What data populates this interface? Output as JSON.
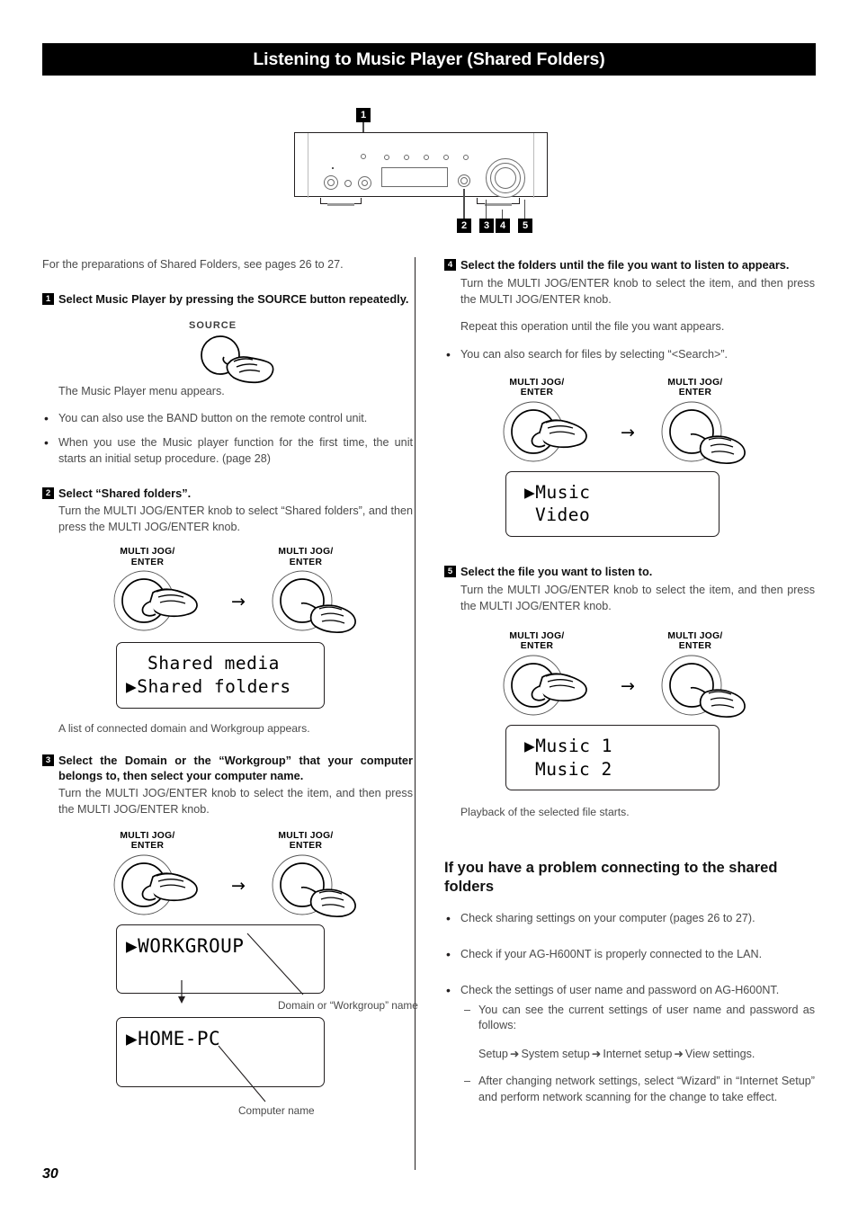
{
  "page": {
    "title": "Listening to Music Player (Shared Folders)",
    "number": "30"
  },
  "device_diagram": {
    "callouts_top": [
      "1"
    ],
    "callouts_bottom": [
      "2",
      "3",
      "4",
      "5"
    ]
  },
  "left_column": {
    "lead_in": "For the preparations of Shared Folders, see pages 26 to 27.",
    "step1": {
      "num": "1",
      "heading": "Select Music Player by pressing the SOURCE button repeatedly.",
      "button_label": "SOURCE",
      "result": "The Music Player menu appears.",
      "bullets": [
        "You can also use the BAND button on the remote control unit.",
        "When you use the Music player function for the first time, the unit starts an initial setup procedure. (page 28)"
      ]
    },
    "step2": {
      "num": "2",
      "heading": "Select “Shared folders”.",
      "body": "Turn the MULTI JOG/ENTER knob to select “Shared folders”, and then press the MULTI JOG/ENTER knob.",
      "knob_label_left": "MULTI JOG/\nENTER",
      "knob_label_right": "MULTI JOG/\nENTER",
      "display_lines": [
        "Shared media",
        "Shared folders"
      ],
      "display_selected_index": 1,
      "result": "A list of connected domain and Workgroup appears."
    },
    "step3": {
      "num": "3",
      "heading": "Select the Domain or the “Workgroup” that your computer belongs to, then select your computer name.",
      "body": "Turn the MULTI JOG/ENTER knob to select the item, and then press the MULTI JOG/ENTER knob.",
      "knob_label_left": "MULTI JOG/\nENTER",
      "knob_label_right": "MULTI JOG/\nENTER",
      "display1_lines": [
        "WORKGROUP"
      ],
      "display1_caption": "Domain or “Workgroup” name",
      "display2_lines": [
        "HOME-PC"
      ],
      "display2_caption": "Computer name"
    }
  },
  "right_column": {
    "step4": {
      "num": "4",
      "heading": "Select the folders until the file you want to listen to appears.",
      "body_lines": [
        "Turn the MULTI JOG/ENTER knob to select the item, and then press the MULTI JOG/ENTER knob.",
        "Repeat this operation until the file you want appears."
      ],
      "bullets": [
        "You can also search for files by selecting “<Search>”."
      ],
      "knob_label_left": "MULTI JOG/\nENTER",
      "knob_label_right": "MULTI JOG/\nENTER",
      "display_lines": [
        "Music",
        "Video"
      ],
      "display_selected_index": 0
    },
    "step5": {
      "num": "5",
      "heading": "Select the file you want to listen to.",
      "body": "Turn the MULTI JOG/ENTER knob to select the item, and then press the MULTI JOG/ENTER knob.",
      "knob_label_left": "MULTI JOG/\nENTER",
      "knob_label_right": "MULTI JOG/\nENTER",
      "display_lines": [
        "Music 1",
        "Music 2"
      ],
      "display_selected_index": 0,
      "result": "Playback of the selected file starts."
    },
    "troubleshooting": {
      "heading": "If you have a problem connecting to the shared folders",
      "bullets": [
        "Check sharing settings on your computer (pages 26 to 27).",
        "Check if your AG-H600NT is properly connected to the LAN.",
        "Check the settings of user name and password on AG-H600NT."
      ],
      "sub_items": [
        "You can see the current settings of user name and password as follows:",
        "After changing network settings, select “Wizard” in “Internet Setup” and perform network scanning for the change to take effect."
      ],
      "path": {
        "a": "Setup",
        "b": "System setup",
        "c": "Internet setup",
        "d": "View settings.",
        "arrow": "➜"
      }
    }
  },
  "colors": {
    "banner_bg": "#000000",
    "banner_text": "#ffffff",
    "body_text": "#3d3d3d",
    "heading_text": "#111111"
  }
}
